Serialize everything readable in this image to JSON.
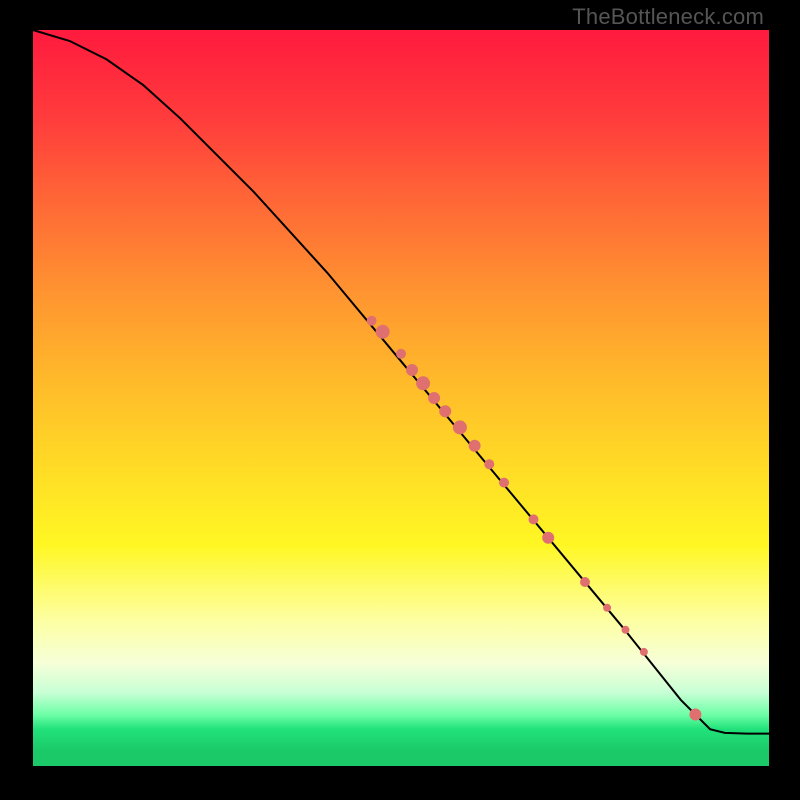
{
  "watermark": "TheBottleneck.com",
  "colors": {
    "point": "#e07070",
    "curve": "#000000"
  },
  "chart_data": {
    "type": "scatter",
    "title": "",
    "xlabel": "",
    "ylabel": "",
    "xlim": [
      0,
      100
    ],
    "ylim": [
      0,
      100
    ],
    "curve_points": [
      [
        0,
        100
      ],
      [
        5,
        98.5
      ],
      [
        10,
        96
      ],
      [
        15,
        92.5
      ],
      [
        20,
        88
      ],
      [
        30,
        78
      ],
      [
        40,
        67
      ],
      [
        50,
        55
      ],
      [
        60,
        43
      ],
      [
        70,
        31
      ],
      [
        80,
        19
      ],
      [
        88,
        9
      ],
      [
        92,
        5
      ],
      [
        94,
        4.5
      ],
      [
        97,
        4.4
      ],
      [
        100,
        4.4
      ]
    ],
    "scatter_points": [
      {
        "x": 46,
        "y": 60.5,
        "r": 5
      },
      {
        "x": 47.5,
        "y": 59,
        "r": 7
      },
      {
        "x": 50,
        "y": 56,
        "r": 5
      },
      {
        "x": 51.5,
        "y": 53.8,
        "r": 6
      },
      {
        "x": 53,
        "y": 52,
        "r": 7
      },
      {
        "x": 54.5,
        "y": 50,
        "r": 6
      },
      {
        "x": 56,
        "y": 48.2,
        "r": 6
      },
      {
        "x": 58,
        "y": 46,
        "r": 7
      },
      {
        "x": 60,
        "y": 43.5,
        "r": 6
      },
      {
        "x": 62,
        "y": 41,
        "r": 5
      },
      {
        "x": 64,
        "y": 38.5,
        "r": 5
      },
      {
        "x": 68,
        "y": 33.5,
        "r": 5
      },
      {
        "x": 70,
        "y": 31,
        "r": 6
      },
      {
        "x": 75,
        "y": 25,
        "r": 5
      },
      {
        "x": 78,
        "y": 21.5,
        "r": 4
      },
      {
        "x": 80.5,
        "y": 18.5,
        "r": 4
      },
      {
        "x": 83,
        "y": 15.5,
        "r": 4
      },
      {
        "x": 90,
        "y": 7,
        "r": 6
      }
    ]
  }
}
